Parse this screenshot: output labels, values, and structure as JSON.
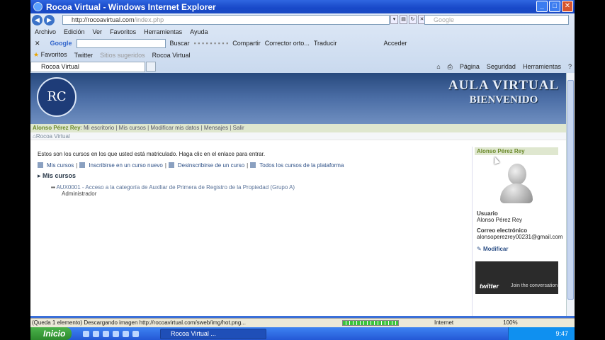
{
  "window": {
    "title": "Rocoa Virtual - Windows Internet Explorer"
  },
  "address": {
    "url_main": "http://rocoavirtual.com",
    "url_path": "/index.php",
    "search_placeholder": "Google"
  },
  "menu": [
    "Archivo",
    "Edición",
    "Ver",
    "Favoritos",
    "Herramientas",
    "Ayuda"
  ],
  "google_bar": {
    "logo": "Google",
    "buscar": "Buscar",
    "compartir": "Compartir",
    "corrector": "Corrector orto...",
    "traducir": "Traducir",
    "acceder": "Acceder"
  },
  "favorites": {
    "label": "Favoritos",
    "twitter": "Twitter",
    "sugeridos": "Sitios sugeridos",
    "rocoa": "Rocoa Virtual"
  },
  "tab": {
    "label": "Rocoa Virtual"
  },
  "commands": {
    "pagina": "Página",
    "seguridad": "Seguridad",
    "herramientas": "Herramientas"
  },
  "banner": {
    "logo_text": "RC",
    "title1": "AULA VIRTUAL",
    "title2": "BIENVENIDO"
  },
  "userbar": {
    "name": "Alonso Pérez Rey",
    "items": ": Mi escritorio | Mis cursos | Modificar mis datos | Mensajes | Salir"
  },
  "breadcrumb": "Rocoa Virtual",
  "main": {
    "intro": "Estos son los cursos en los que usted está matriculado. Haga clic en el enlace para entrar.",
    "links": [
      "Mis cursos",
      "Inscribirse en un curso nuevo",
      "Desinscribirse de un curso",
      "Todos los cursos de la plataforma"
    ],
    "section": "Mis cursos",
    "course": "AUX0001 - Acceso a la categoría de Auxiliar de Primera de Registro de la Propiedad (Grupo A)",
    "course_role": "Administrador"
  },
  "profile": {
    "header": "Alonso Pérez Rey",
    "user_label": "Usuario",
    "user_value": "Alonso Pérez Rey",
    "email_label": "Correo electrónico",
    "email_value": "alonsoperezrey00231@gmail.com",
    "modify": "Modificar"
  },
  "twitter_box": {
    "brand": "twitter",
    "cta": "Join the conversation"
  },
  "status": {
    "text": "(Queda 1 elemento) Descargando imagen http://rocoavirtual.com/sweb/img/hot.png...",
    "zone": "Internet",
    "zoom": "100%",
    "progress": 1.0
  },
  "taskbar": {
    "start": "Inicio",
    "item": "Rocoa Virtual ...",
    "clock": "9:47"
  }
}
